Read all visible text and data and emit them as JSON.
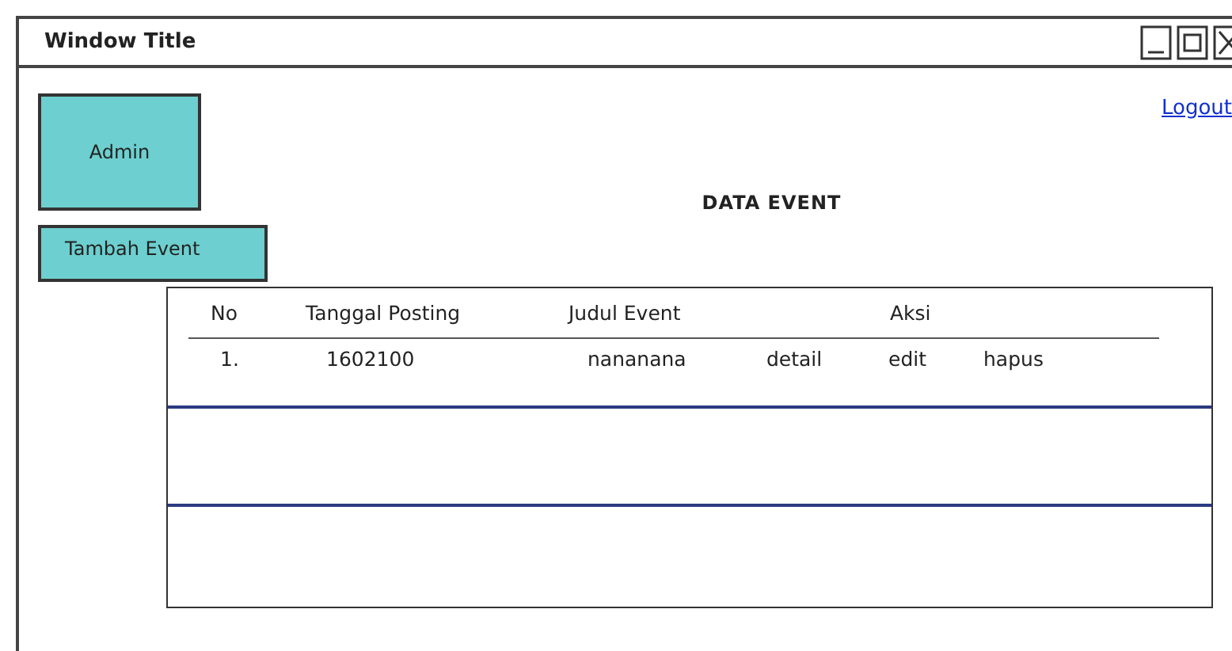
{
  "window": {
    "title": "Window Title"
  },
  "admin_box": {
    "label": "Admin"
  },
  "add_button": {
    "label": "Tambah Event"
  },
  "logout_link": {
    "label": "Logout"
  },
  "heading": "DATA EVENT",
  "table": {
    "columns": [
      "No",
      "Tanggal Posting",
      "Judul Event",
      "Aksi"
    ],
    "rows": [
      {
        "cells": [
          "1.",
          "1602100",
          "nananana"
        ],
        "actions": [
          "detail",
          "edit",
          "hapus"
        ]
      }
    ]
  }
}
